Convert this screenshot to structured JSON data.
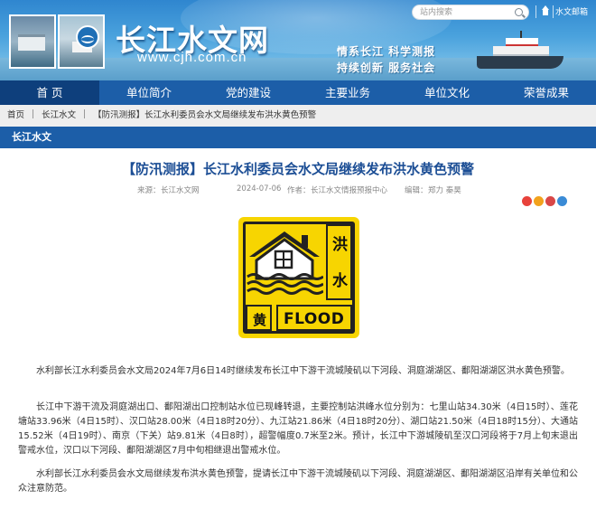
{
  "header": {
    "site_title": "长江水文网",
    "site_domain": "www.cjh.com.cn",
    "slogan_line1": "情系长江  科学测报",
    "slogan_line2": "持续创新  服务社会",
    "search_placeholder": "站内搜索",
    "mail_label": "水文邮箱"
  },
  "nav": {
    "items": [
      "首 页",
      "单位简介",
      "党的建设",
      "主要业务",
      "单位文化",
      "荣誉成果"
    ],
    "active_index": 0
  },
  "breadcrumb": {
    "items": [
      "首页",
      "长江水文",
      "【防汛测报】长江水利委员会水文局继续发布洪水黄色预警"
    ]
  },
  "section": {
    "title": "长江水文"
  },
  "article": {
    "title": "【防汛测报】长江水利委员会水文局继续发布洪水黄色预警",
    "source_label": "来源：",
    "source": "长江水文网",
    "date": "2024-07-06",
    "author_label": "作者：",
    "author": "长江水文情报预报中心",
    "editor_label": "编辑：",
    "editor": "郑力 秦昊",
    "share_colors": [
      "#e8423b",
      "#f2a21d",
      "#d94747",
      "#3a8bd6"
    ],
    "sign": {
      "text_cn_top": "洪",
      "text_cn_bottom": "水",
      "text_level": "黄",
      "text_en": "FLOOD",
      "color": "#f7d501"
    },
    "paragraphs": [
      "水利部长江水利委员会水文局2024年7月6日14时继续发布长江中下游干流城陵矶以下河段、洞庭湖湖区、鄱阳湖湖区洪水黄色预警。",
      "长江中下游干流及洞庭湖出口、鄱阳湖出口控制站水位已现峰转退，主要控制站洪峰水位分别为：七里山站34.30米（4日15时）、莲花塘站33.96米（4日15时）、汉口站28.00米（4日18时20分）、九江站21.86米（4日18时20分）、湖口站21.50米（4日18时15分）、大通站15.52米（4日19时）、南京（下关）站9.81米（4日8时），超警幅度0.7米至2米。预计，长江中下游城陵矶至汉口河段将于7月上旬末退出警戒水位，汉口以下河段、鄱阳湖湖区7月中旬相继退出警戒水位。",
      "水利部长江水利委员会水文局继续发布洪水黄色预警，提请长江中下游干流城陵矶以下河段、洞庭湖湖区、鄱阳湖湖区沿岸有关单位和公众注意防范。"
    ]
  },
  "colors": {
    "nav_bg": "#1c5ea8",
    "nav_active": "#0e3f7c",
    "title_blue": "#1c4e95",
    "warning_yellow": "#f7d501"
  }
}
